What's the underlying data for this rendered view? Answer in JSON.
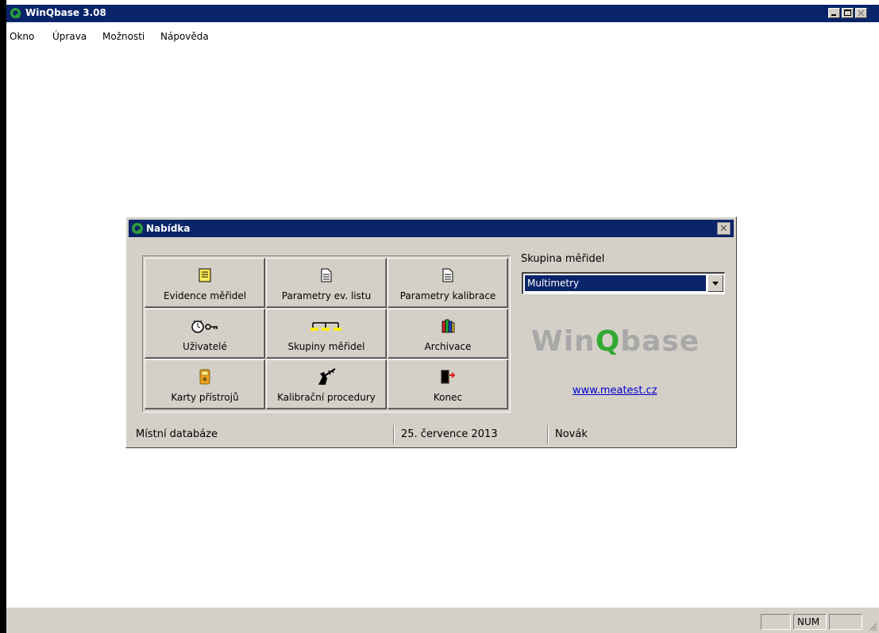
{
  "app": {
    "title": "WinQbase 3.08",
    "colors": {
      "titlebar": "#0a246a",
      "face": "#d4d0c8",
      "logo_gray": "#a8a8a8",
      "logo_green": "#33aa33"
    }
  },
  "menubar": {
    "items": [
      {
        "label": "Okno"
      },
      {
        "label": "Úprava"
      },
      {
        "label": "Možnosti"
      },
      {
        "label": "Nápověda"
      }
    ]
  },
  "dialog": {
    "title": "Nabídka",
    "buttons": [
      {
        "label": "Evidence měřidel",
        "icon": "register-icon"
      },
      {
        "label": "Parametry ev. listu",
        "icon": "document-icon"
      },
      {
        "label": "Parametry kalibrace",
        "icon": "document-icon"
      },
      {
        "label": "Uživatelé",
        "icon": "users-clock-key-icon"
      },
      {
        "label": "Skupiny měřidel",
        "icon": "groups-icon"
      },
      {
        "label": "Archivace",
        "icon": "books-icon"
      },
      {
        "label": "Karty přístrojů",
        "icon": "multimeter-icon"
      },
      {
        "label": "Kalibrační procedury",
        "icon": "calibration-icon"
      },
      {
        "label": "Konec",
        "icon": "exit-door-icon"
      }
    ],
    "group_label": "Skupina měřidel",
    "group_value": "Multimetry",
    "logo": {
      "part1": "Win",
      "part2": "Q",
      "part3": "base"
    },
    "website": "www.meatest.cz",
    "status": {
      "database": "Místní databáze",
      "date": "25. července 2013",
      "user": "Novák"
    }
  },
  "statusbar": {
    "num": "NUM"
  }
}
